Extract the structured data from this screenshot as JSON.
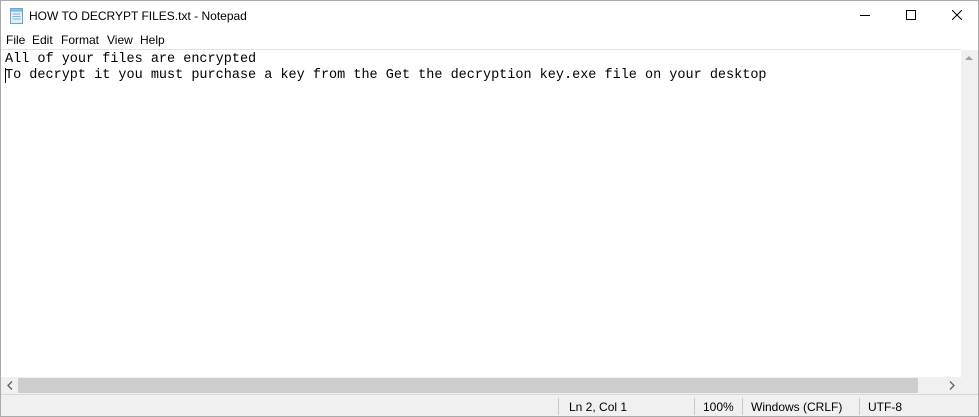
{
  "window": {
    "title": "HOW TO DECRYPT FILES.txt - Notepad",
    "icon": "notepad-icon"
  },
  "menu": {
    "file": "File",
    "edit": "Edit",
    "format": "Format",
    "view": "View",
    "help": "Help"
  },
  "document": {
    "lines": [
      "All of your files are encrypted",
      "To decrypt it you must purchase a key from the Get the decryption key.exe file on your desktop"
    ]
  },
  "status": {
    "position": "Ln 2, Col 1",
    "zoom": "100%",
    "line_ending": "Windows (CRLF)",
    "encoding": "UTF-8"
  },
  "colors": {
    "window_bg": "#ffffff",
    "statusbar_bg": "#f0f0f0",
    "scroll_thumb": "#cdcdcd"
  }
}
